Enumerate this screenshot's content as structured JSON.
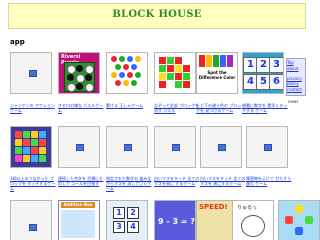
{
  "header": {
    "title": "BLOCK HOUSE"
  },
  "section": {
    "label": "app"
  },
  "row1": {
    "tiles": [
      {
        "caption": "ジャンケンの アクションゲーム",
        "banner": ""
      },
      {
        "caption": "オセロの様な パズルゲーム",
        "banner": "Riversi Puzzle"
      },
      {
        "caption": "繋げる 玉しゃゲーム",
        "banner": ""
      },
      {
        "caption": "なぞって全部 ブロックを消す パズル",
        "banner": ""
      },
      {
        "caption": "上と下の違う色の ブロックを 見つけるゲーム",
        "banner": "Spot the Difference Color"
      },
      {
        "caption": "順番に数字を 素早くタッチする ゲーム",
        "banner": ""
      }
    ],
    "numkeys": [
      "1",
      "2",
      "3",
      "4",
      "5",
      "6"
    ]
  },
  "side": {
    "links": [
      "Top",
      "about",
      "privacy",
      "policy",
      "contact"
    ],
    "news_label": "news"
  },
  "row2": {
    "tiles": [
      {
        "caption": "3個以上のつながった ブロックを タッチするゲーム"
      },
      {
        "caption": "連続した合計を 目標にたのしで ゴールを目指す"
      },
      {
        "caption": "指定された数字分 進みながらマスを 消していくゲーム"
      },
      {
        "caption": "白いマスをタッチ 全ての マスを黒に するゲーム"
      },
      {
        "caption": "白いマスをタッチ 全てのマスを 黒にするゲーム"
      },
      {
        "caption": "障害物をよけて ひたすら進む ゲーム"
      }
    ]
  },
  "row3": {
    "addbox_header": "Addition Box",
    "numgrid": [
      "1",
      "2",
      "3",
      "4"
    ],
    "equation": "9 - 3 = ?",
    "speed_label": "SPEED!",
    "sketch_label": "りゅるっ"
  }
}
